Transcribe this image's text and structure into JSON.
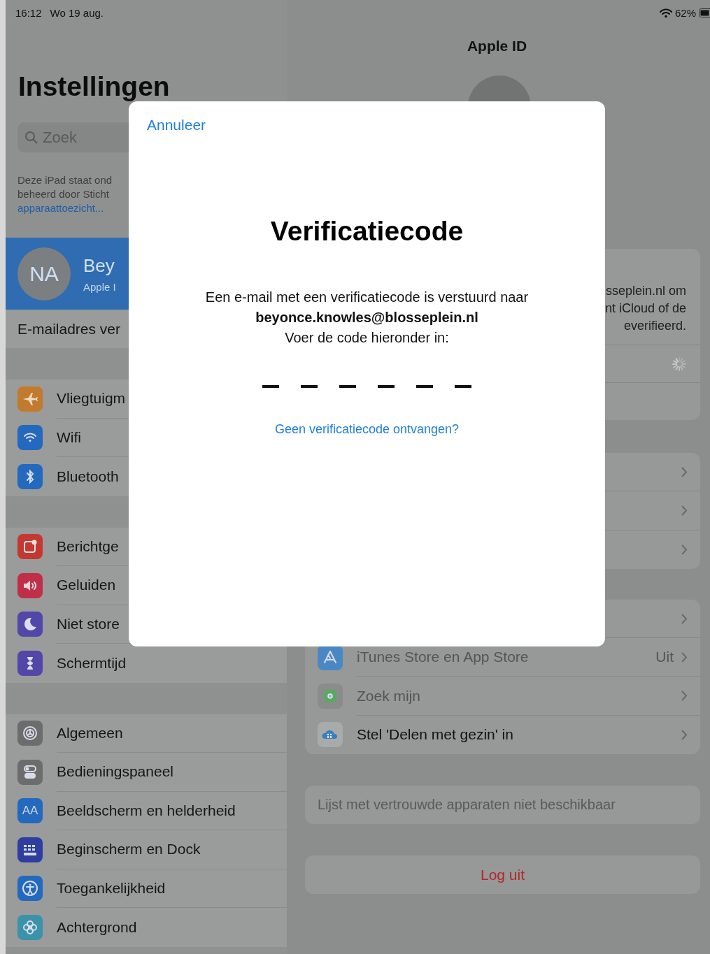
{
  "status_bar": {
    "time": "16:12",
    "date": "Wo 19 aug.",
    "battery": "62%"
  },
  "sidebar": {
    "title": "Instellingen",
    "search": {
      "placeholder": "Zoek"
    },
    "supervision_note": {
      "lines": [
        "Deze iPad staat ond",
        "beheerd door Sticht"
      ],
      "link": "apparaattoezicht..."
    },
    "profile": {
      "initials": "NA",
      "name": "Bey",
      "subtitle": "Apple I",
      "selected": true
    },
    "email_row": "E-mailadres ver",
    "groups": [
      {
        "items": [
          {
            "label": "Vliegtuigm",
            "color": "#c27a2c"
          },
          {
            "label": "Wifi",
            "color": "#2369bd"
          },
          {
            "label": "Bluetooth",
            "color": "#2369bd"
          }
        ]
      },
      {
        "items": [
          {
            "label": "Berichtge",
            "color": "#c4392f"
          },
          {
            "label": "Geluiden",
            "color": "#c02f48"
          },
          {
            "label": "Niet store",
            "color": "#5047a8"
          },
          {
            "label": "Schermtijd",
            "color": "#5047a8"
          }
        ]
      },
      {
        "items": [
          {
            "label": "Algemeen",
            "color": "#6c6c6c"
          },
          {
            "label": "Bedieningspaneel",
            "color": "#6c6c6c"
          },
          {
            "label": "Beeldscherm en helderheid",
            "color": "#2369bd",
            "glyph": "AA"
          },
          {
            "label": "Beginscherm en Dock",
            "color": "#2d3ea0"
          },
          {
            "label": "Toegankelijkheid",
            "color": "#2369bd"
          },
          {
            "label": "Achtergrond",
            "color": "#3a93aa"
          }
        ]
      }
    ]
  },
  "detail": {
    "title": "Apple ID",
    "verify_card": {
      "lines": [
        "sseplein.nl om",
        "nt iCloud of de",
        "everifieerd."
      ],
      "loading": true
    },
    "cards": [
      {
        "rows": [
          {
            "kind": "covered"
          },
          {
            "kind": "covered"
          },
          {
            "kind": "covered"
          }
        ]
      },
      {
        "rows": [
          {
            "kind": "covered"
          },
          {
            "kind": "link",
            "label": "iTunes Store en App Store",
            "value": "Uit",
            "disabled": true
          },
          {
            "kind": "link",
            "label": "Zoek mijn",
            "disabled": true
          },
          {
            "kind": "link",
            "label": "Stel 'Delen met gezin' in",
            "disabled": false
          }
        ]
      }
    ],
    "trusted_devices": "Lijst met vertrouwde apparaten niet beschikbaar",
    "sign_out": "Log uit"
  },
  "dialog": {
    "cancel": "Annuleer",
    "title": "Verificatiecode",
    "message": [
      "Een e-mail met een verificatiecode is verstuurd naar",
      "**beyonce.knowles@blosseplein.nl**",
      "Voer de code hieronder in:"
    ],
    "code_slots": [
      {
        "filled": false
      },
      {
        "filled": false
      },
      {
        "filled": false
      },
      {
        "filled": false
      },
      {
        "filled": false
      },
      {
        "filled": false
      }
    ],
    "resend_link": "Geen verificatiecode ontvangen?"
  }
}
